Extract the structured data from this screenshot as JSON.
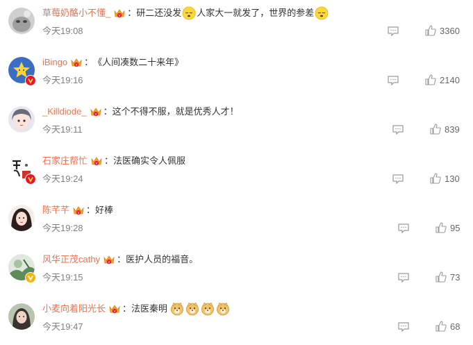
{
  "comments": [
    {
      "username": "草莓奶酪小不懂_",
      "colon": "：",
      "text_parts": [
        "研二还没发",
        "人家大一就发了，世界的参差",
        ""
      ],
      "time": "今天19:08",
      "likes": "3360",
      "avatar_style": "gray-cat",
      "verified": false,
      "emoji": "face-emoji"
    },
    {
      "username": "iBingo",
      "colon": "：",
      "text_parts": [
        "《人间凑数二十来年》"
      ],
      "time": "今天19:16",
      "likes": "2140",
      "avatar_style": "star",
      "verified": true
    },
    {
      "username": "_Killdiode_",
      "colon": "：",
      "text_parts": [
        "这个不得不服，就是优秀人才！"
      ],
      "time": "今天19:11",
      "likes": "839",
      "avatar_style": "anime-face",
      "verified": false
    },
    {
      "username": "石家庄帮忙",
      "colon": "：",
      "text_parts": [
        "法医确实令人佩服"
      ],
      "time": "今天19:24",
      "likes": "130",
      "avatar_style": "calligraphy",
      "verified": true
    },
    {
      "username": "陈芊芊",
      "colon": "：",
      "text_parts": [
        "好棒"
      ],
      "time": "今天19:28",
      "likes": "95",
      "avatar_style": "portrait-girl",
      "verified": false
    },
    {
      "username": "风华正茂cathy",
      "colon": "：",
      "text_parts": [
        "医护人员的福音。"
      ],
      "time": "今天19:15",
      "likes": "73",
      "avatar_style": "green-photo",
      "verified": true,
      "verified_color": "#f6b40b"
    },
    {
      "username": "小麦向着阳光长",
      "colon": "：",
      "text_parts": [
        "法医秦明"
      ],
      "time": "今天19:47",
      "likes": "68",
      "avatar_style": "portrait-dark",
      "verified": false,
      "emoji": "doge-emoji"
    }
  ],
  "icons": {
    "reply": "comment-icon",
    "like": "thumbs-up-icon",
    "crown": "vip-crown-icon",
    "verified": "verified-v-icon"
  },
  "colors": {
    "username": "#eb7350",
    "time": "#808080",
    "icon": "#9a9a9a",
    "verified_red": "#e6162d",
    "verified_yellow": "#f6b40b"
  }
}
